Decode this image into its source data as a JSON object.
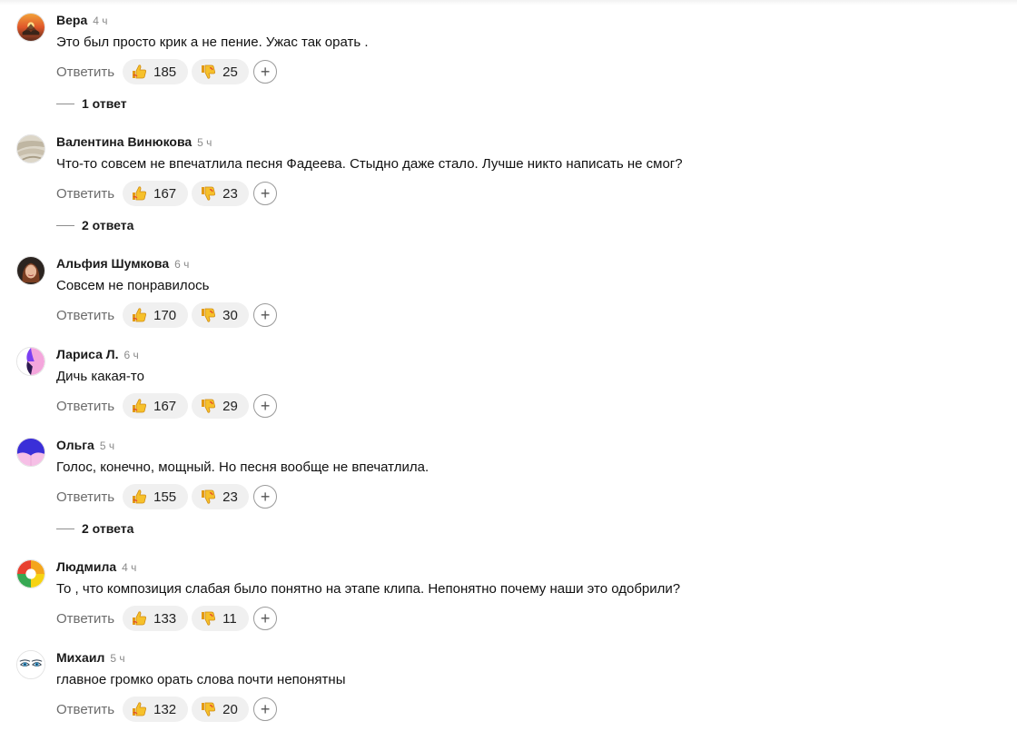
{
  "ui": {
    "reply_label": "Ответить",
    "add_reaction_symbol": "+",
    "like_icon": "thumbs-up-icon",
    "dislike_icon": "thumbs-down-icon",
    "accent_like": "#f4b400",
    "accent_dislike": "#f4b400"
  },
  "comments": [
    {
      "author": "Вера",
      "time": "4 ч",
      "text": "Это был просто крик а не пение. Ужас так орать .",
      "likes": "185",
      "dislikes": "25",
      "replies_label": "1 ответ",
      "avatar": "sunset-avatar"
    },
    {
      "author": "Валентина Винюкова",
      "time": "5 ч",
      "text": "Что-то совсем не впечатлила песня Фадеева. Стыдно даже стало. Лучше никто написать не смог?",
      "likes": "167",
      "dislikes": "23",
      "replies_label": "2 ответа",
      "avatar": "pale-photo-avatar"
    },
    {
      "author": "Альфия Шумкова",
      "time": "6 ч",
      "text": "Совсем не понравилось",
      "likes": "170",
      "dislikes": "30",
      "replies_label": "",
      "avatar": "portrait-avatar"
    },
    {
      "author": "Лариса Л.",
      "time": "6 ч",
      "text": "Дичь какая-то",
      "likes": "167",
      "dislikes": "29",
      "replies_label": "",
      "avatar": "purple-pink-avatar"
    },
    {
      "author": "Ольга",
      "time": "5 ч",
      "text": "Голос, конечно, мощный. Но песня вообще не впечатлила.",
      "likes": "155",
      "dislikes": "23",
      "replies_label": "2 ответа",
      "avatar": "blue-pink-avatar"
    },
    {
      "author": "Людмила",
      "time": "4 ч",
      "text": "То , что композиция слабая было понятно на этапе клипа. Непонятно почему наши это одобрили?",
      "likes": "133",
      "dislikes": "11",
      "replies_label": "",
      "avatar": "color-wheel-avatar"
    },
    {
      "author": "Михаил",
      "time": "5 ч",
      "text": "главное громко орать слова почти непонятны",
      "likes": "132",
      "dislikes": "20",
      "replies_label": "",
      "avatar": "eyes-avatar"
    }
  ]
}
